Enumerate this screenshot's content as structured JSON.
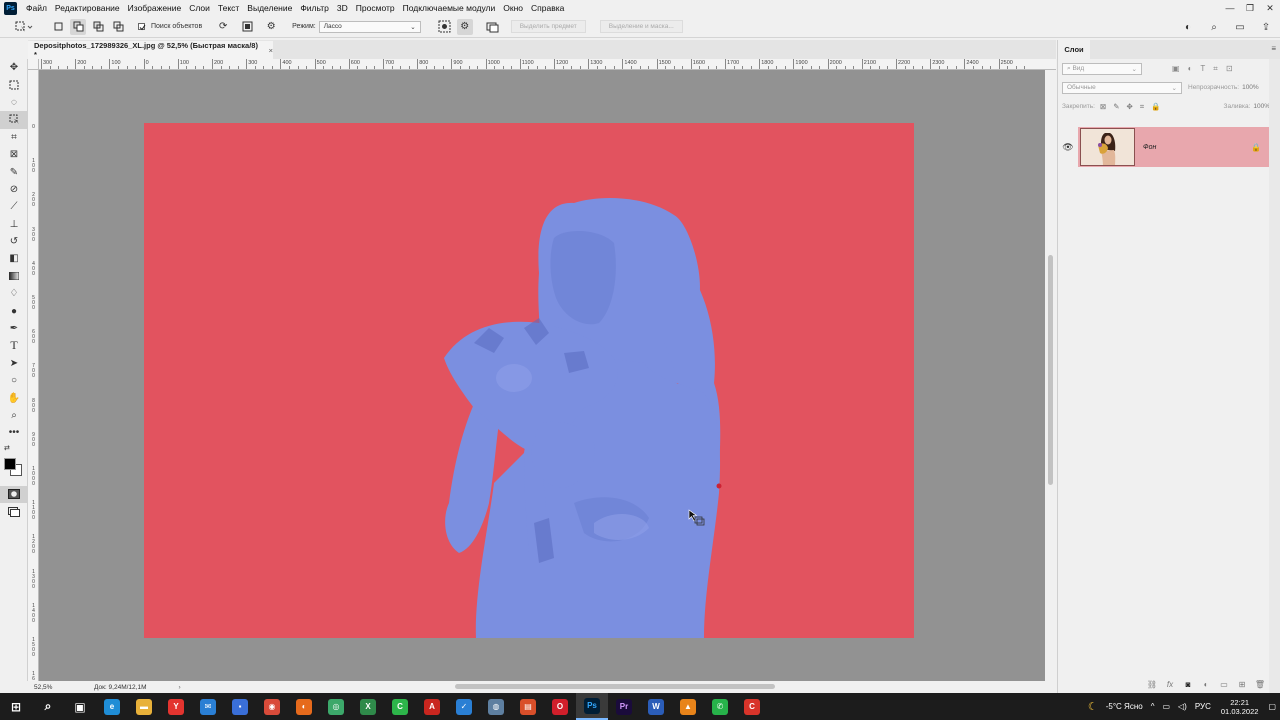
{
  "menu": {
    "logo": "Ps",
    "items": [
      "Файл",
      "Редактирование",
      "Изображение",
      "Слои",
      "Текст",
      "Выделение",
      "Фильтр",
      "3D",
      "Просмотр",
      "Подключаемые модули",
      "Окно",
      "Справка"
    ]
  },
  "window_controls": {
    "minimize": "—",
    "restore": "❐",
    "close": "✕"
  },
  "options": {
    "object_finder_label": "Поиск объектов",
    "object_finder_checked": true,
    "mode_label": "Режим:",
    "mode_value": "Лассо",
    "select_subject": "Выделить предмет",
    "select_and_mask": "Выделение и маска..."
  },
  "document": {
    "tab_title": "Depositphotos_172989326_XL.jpg @ 52,5% (Быстрая маска/8) *",
    "close": "×",
    "zoom": "52,5%",
    "doc_info": "Док: 9,24M/12,1M",
    "arrow": "›"
  },
  "ruler": {
    "top": [
      "300",
      "200",
      "100",
      "0",
      "100",
      "200",
      "300",
      "400",
      "500",
      "600",
      "700",
      "800",
      "900",
      "1000",
      "1100",
      "1200",
      "1300",
      "1400",
      "1500",
      "1600",
      "1700",
      "1800",
      "1900",
      "2000",
      "2100",
      "2200",
      "2300",
      "2400",
      "2500"
    ],
    "left": [
      "0",
      "1\n0\n0",
      "2\n0\n0",
      "3\n0\n0",
      "4\n0\n0",
      "5\n0\n0",
      "6\n0\n0",
      "7\n0\n0",
      "8\n0\n0",
      "9\n0\n0",
      "1\n0\n0\n0",
      "1\n1\n0\n0",
      "1\n2\n0\n0",
      "1\n3\n0\n0",
      "1\n4\n0\n0",
      "1\n5\n0\n0",
      "1\n6\n0\n0"
    ]
  },
  "layers_panel": {
    "tab": "Слои",
    "filter_placeholder": "Вид",
    "blend_mode": "Обычные",
    "opacity_label": "Непрозрачность:",
    "opacity_value": "100%",
    "lock_label": "Закрепить:",
    "fill_label": "Заливка:",
    "fill_value": "100%",
    "layer_name": "Фон"
  },
  "colors": {
    "mask_red": "#e2535f",
    "mask_blue": "#7b8fe0",
    "canvas_gray": "#929292",
    "layer_selected": "#e8a7ad"
  },
  "taskbar": {
    "apps": [
      {
        "name": "start",
        "glyph": "⊞",
        "color": "#1c1c1c"
      },
      {
        "name": "search",
        "glyph": "⌕",
        "color": "#1c1c1c"
      },
      {
        "name": "task-view",
        "glyph": "▣",
        "color": "#1c1c1c"
      },
      {
        "name": "edge",
        "glyph": "e",
        "color": "#1f8dd6"
      },
      {
        "name": "explorer",
        "glyph": "▬",
        "color": "#e8b13a"
      },
      {
        "name": "yandex",
        "glyph": "Y",
        "color": "#e3342f"
      },
      {
        "name": "mail",
        "glyph": "✉",
        "color": "#2a7fd4"
      },
      {
        "name": "save",
        "glyph": "▪",
        "color": "#3a6fd8"
      },
      {
        "name": "chrome",
        "glyph": "◉",
        "color": "#d94b3a"
      },
      {
        "name": "firefox",
        "glyph": "◐",
        "color": "#e66a1c"
      },
      {
        "name": "app-green",
        "glyph": "◎",
        "color": "#3ca86a"
      },
      {
        "name": "excel",
        "glyph": "X",
        "color": "#2f8a4a"
      },
      {
        "name": "camtasia",
        "glyph": "C",
        "color": "#2db54a"
      },
      {
        "name": "acrobat",
        "glyph": "A",
        "color": "#c9261f"
      },
      {
        "name": "tick",
        "glyph": "✓",
        "color": "#2a7fd4"
      },
      {
        "name": "app-globe",
        "glyph": "◍",
        "color": "#5e7fa0"
      },
      {
        "name": "app-doc",
        "glyph": "▤",
        "color": "#d94f2a"
      },
      {
        "name": "opera",
        "glyph": "O",
        "color": "#d11f2b"
      },
      {
        "name": "photoshop",
        "glyph": "Ps",
        "color": "#001e36"
      },
      {
        "name": "premiere",
        "glyph": "Pr",
        "color": "#1a0b3b"
      },
      {
        "name": "word",
        "glyph": "W",
        "color": "#2b5db8"
      },
      {
        "name": "vlc",
        "glyph": "▲",
        "color": "#e8841a"
      },
      {
        "name": "whatsapp",
        "glyph": "✆",
        "color": "#27b24a"
      },
      {
        "name": "app-red",
        "glyph": "C",
        "color": "#d8342a"
      }
    ],
    "weather_icon": "☾",
    "weather": "-5°C Ясно",
    "tray_arrow": "^",
    "language": "РУС",
    "time": "22:21",
    "date": "01.03.2022"
  }
}
